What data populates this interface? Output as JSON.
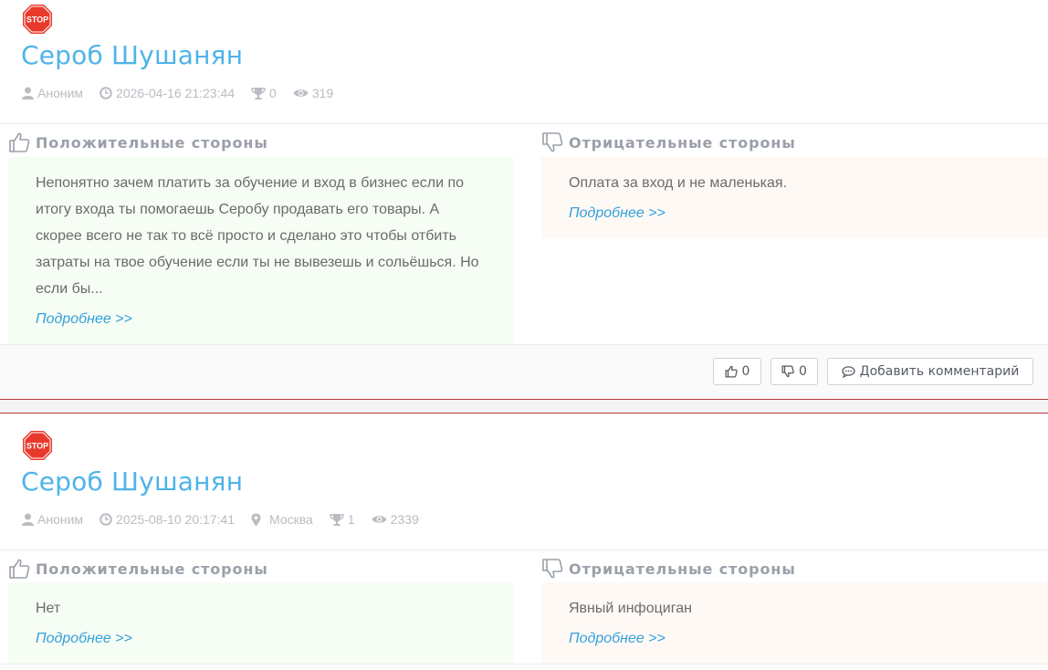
{
  "reviews": [
    {
      "badge": "STOP",
      "title": "Сероб Шушанян",
      "author": "Аноним",
      "date": "2026-04-16 21:23:44",
      "trophies": "0",
      "views": "319",
      "pros_heading": "Положительные стороны",
      "pros_text": "Непонятно зачем платить за обучение и вход в бизнес если по итогу входа ты помогаешь Серобу продавать его товары. А скорее всего не так то всё просто и сделано это чтобы отбить затраты на твое обучение если ты не вывезешь и сольёшься. Но если бы...",
      "pros_more": "Подробнее >>",
      "cons_heading": "Отрицательные стороны",
      "cons_text": "Оплата за вход и не маленькая.",
      "cons_more": "Подробнее >>",
      "likes": "0",
      "dislikes": "0",
      "comment_label": "Добавить комментарий"
    },
    {
      "badge": "STOP",
      "title": "Сероб Шушанян",
      "author": "Аноним",
      "date": "2025-08-10 20:17:41",
      "location": "Москва",
      "trophies": "1",
      "views": "2339",
      "pros_heading": "Положительные стороны",
      "pros_text": "Нет",
      "pros_more": "Подробнее >>",
      "cons_heading": "Отрицательные стороны",
      "cons_text": "Явный инфоциган",
      "cons_more": "Подробнее >>"
    }
  ],
  "icons": {
    "badge": "stop-sign-icon",
    "author": "user-icon",
    "date": "clock-icon",
    "location": "map-marker-icon",
    "trophies": "trophy-icon",
    "views": "eye-icon",
    "pros": "thumbs-up-outline-icon",
    "cons": "thumbs-down-outline-icon",
    "comment": "comment-icon"
  },
  "colors": {
    "title": "#4fb3ea",
    "link": "#34a0dc",
    "pros_bg": "#f6fdf4",
    "cons_bg": "#fff9f6",
    "badge": "#e83a2c",
    "separator": "#b63a3a"
  }
}
